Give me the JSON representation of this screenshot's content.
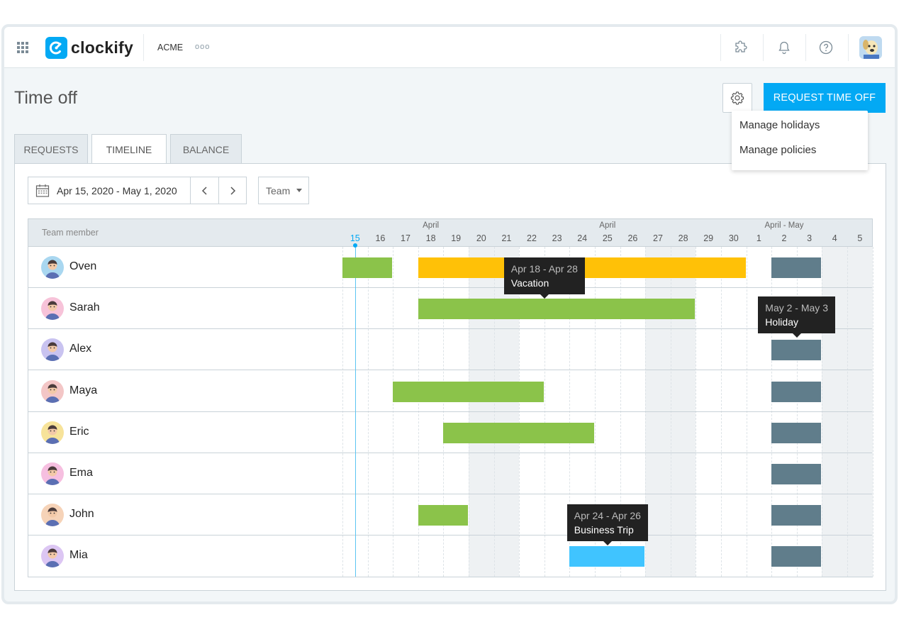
{
  "app": {
    "brand": "clockify",
    "workspace": "ACME",
    "workspace_more": "ooo"
  },
  "page": {
    "title": "Time off",
    "request_button": "REQUEST TIME OFF",
    "settings_menu": [
      "Manage holidays",
      "Manage policies"
    ]
  },
  "tabs": [
    "REQUESTS",
    "TIMELINE",
    "BALANCE"
  ],
  "active_tab": "TIMELINE",
  "filters": {
    "date_range": "Apr 15, 2020 - May 1, 2020",
    "group_by": "Team"
  },
  "timeline": {
    "member_column": "Team member",
    "months": [
      "April",
      "April",
      "April - May"
    ],
    "days": [
      "15",
      "16",
      "17",
      "18",
      "19",
      "20",
      "21",
      "22",
      "23",
      "24",
      "25",
      "26",
      "27",
      "28",
      "29",
      "30",
      "1",
      "2",
      "3",
      "4",
      "5"
    ],
    "today_index": 0,
    "weekend_indices": [
      5,
      6,
      12,
      13,
      19,
      20
    ],
    "members": [
      {
        "name": "Oven",
        "avatar_color": "#a9d7f0"
      },
      {
        "name": "Sarah",
        "avatar_color": "#f7c3d9"
      },
      {
        "name": "Alex",
        "avatar_color": "#c9c3f0"
      },
      {
        "name": "Maya",
        "avatar_color": "#f3c6c6"
      },
      {
        "name": "Eric",
        "avatar_color": "#f7e39a"
      },
      {
        "name": "Ema",
        "avatar_color": "#f6bfe0"
      },
      {
        "name": "John",
        "avatar_color": "#f6d3b8"
      },
      {
        "name": "Mia",
        "avatar_color": "#dcc6f3"
      }
    ],
    "colors": {
      "green": "#8bc34a",
      "yellow": "#ffc107",
      "gray": "#607d8b",
      "blue": "#40c4ff",
      "accent": "#03a9f4"
    },
    "bars": [
      {
        "row": 0,
        "start": 0,
        "end": 1,
        "color": "green"
      },
      {
        "row": 0,
        "start": 3,
        "end": 15,
        "color": "yellow"
      },
      {
        "row": 0,
        "start": 17,
        "end": 18,
        "color": "gray"
      },
      {
        "row": 1,
        "start": 3,
        "end": 13,
        "color": "green"
      },
      {
        "row": 2,
        "start": 17,
        "end": 18,
        "color": "gray"
      },
      {
        "row": 3,
        "start": 2,
        "end": 7,
        "color": "green"
      },
      {
        "row": 3,
        "start": 17,
        "end": 18,
        "color": "gray"
      },
      {
        "row": 4,
        "start": 4,
        "end": 9,
        "color": "green"
      },
      {
        "row": 4,
        "start": 17,
        "end": 18,
        "color": "gray"
      },
      {
        "row": 5,
        "start": 17,
        "end": 18,
        "color": "gray"
      },
      {
        "row": 6,
        "start": 3,
        "end": 4,
        "color": "green"
      },
      {
        "row": 6,
        "start": 17,
        "end": 18,
        "color": "gray"
      },
      {
        "row": 7,
        "start": 9,
        "end": 11,
        "color": "blue"
      },
      {
        "row": 7,
        "start": 17,
        "end": 18,
        "color": "gray"
      }
    ],
    "tooltips": [
      {
        "dates": "Apr 18 - Apr 28",
        "label": "Vacation",
        "row": 0
      },
      {
        "dates": "May 2 - May 3",
        "label": "Holiday",
        "row": 1
      },
      {
        "dates": "Apr 24 - Apr 26",
        "label": "Business Trip",
        "row": 7
      }
    ]
  }
}
